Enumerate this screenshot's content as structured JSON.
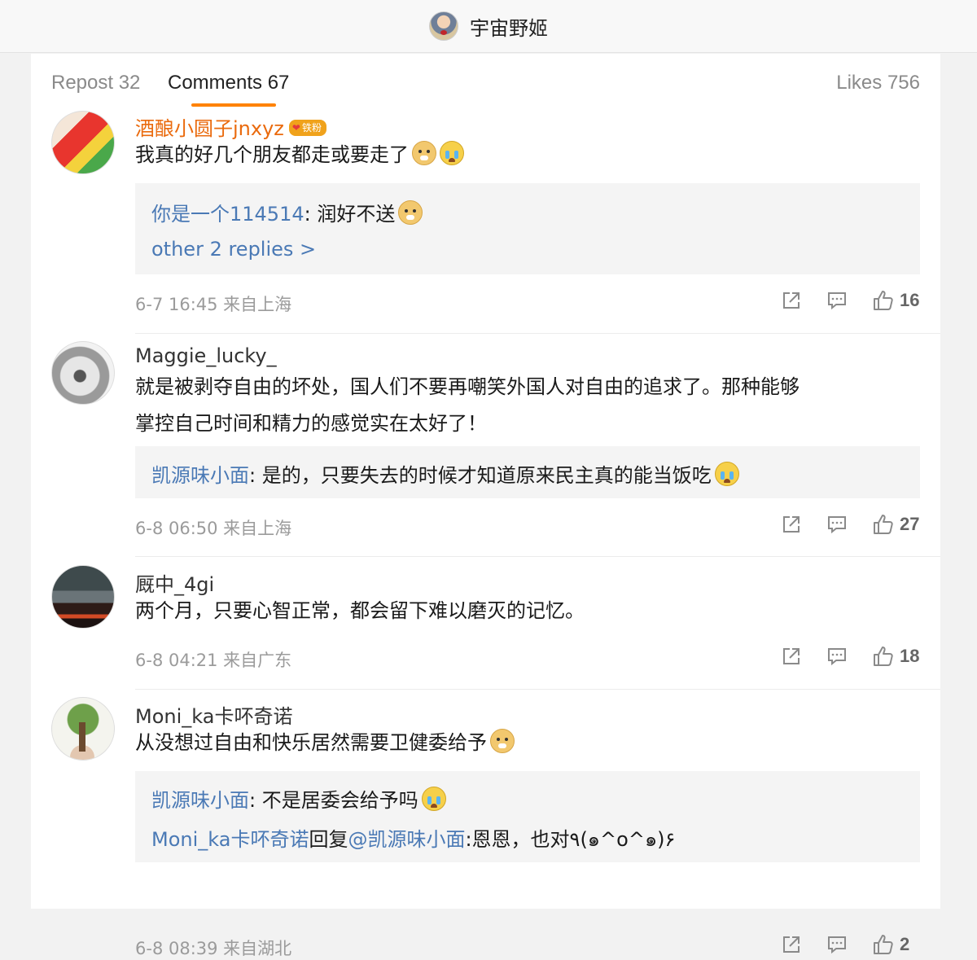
{
  "header": {
    "title": "宇宙野姬"
  },
  "tabs": {
    "repost": "Repost 32",
    "comments": "Comments 67",
    "likes": "Likes 756"
  },
  "comments": [
    {
      "user": "酒酿小圆子jnxyz",
      "badge": "铁粉",
      "text": "我真的好几个朋友都走或要走了",
      "replies": [
        {
          "user": "你是一个114514",
          "sep": ": ",
          "text": "润好不送"
        }
      ],
      "more": "other 2 replies >",
      "time": "6-7 16:45 来自上海",
      "likes": "16"
    },
    {
      "user": "Maggie_lucky_",
      "text_line1": "就是被剥夺自由的坏处，国人们不要再嘲笑外国人对自由的追求了。那种能够",
      "text_line2": "掌控自己时间和精力的感觉实在太好了！",
      "replies": [
        {
          "user": "凯源味小面",
          "sep": ": ",
          "text": "是的，只要失去的时候才知道原来民主真的能当饭吃"
        }
      ],
      "time": "6-8 06:50 来自上海",
      "likes": "27"
    },
    {
      "user": "厩中_4gi",
      "text": "两个月，只要心智正常，都会留下难以磨灭的记忆。",
      "time": "6-8 04:21 来自广东",
      "likes": "18"
    },
    {
      "user": "Moni_ka卡吥奇诺",
      "text": "从没想过自由和快乐居然需要卫健委给予",
      "replies": [
        {
          "user": "凯源味小面",
          "sep": ": ",
          "text": "不是居委会给予吗"
        },
        {
          "user": "Moni_ka卡吥奇诺",
          "mid": "回复",
          "mention": "@凯源味小面",
          "text": ":恩恩，也对٩(๑^o^๑)۶"
        }
      ],
      "time": "6-8 08:39 来自湖北",
      "likes": "2"
    }
  ],
  "icons": [
    "share-icon",
    "comment-icon",
    "like-icon",
    "dog-emoji",
    "cry-emoji"
  ],
  "colors": {
    "accent": "#ff8200",
    "link": "#4a79b5",
    "vip_name": "#ea6a0d"
  }
}
